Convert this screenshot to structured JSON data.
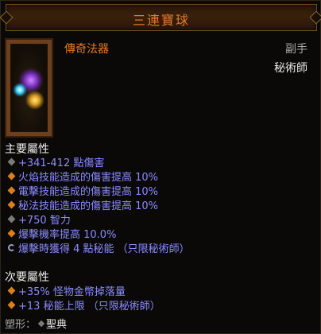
{
  "header": {
    "title": "三連寶球"
  },
  "item": {
    "type": "傳奇法器",
    "slot": "副手",
    "class_requirement": "秘術師"
  },
  "primary": {
    "title": "主要屬性",
    "stats": [
      {
        "text": "+341-412 點傷害",
        "bullet": "grey"
      },
      {
        "text": "火焰技能造成的傷害提高 10%",
        "bullet": "orange"
      },
      {
        "text": "電擊技能造成的傷害提高 10%",
        "bullet": "orange"
      },
      {
        "text": "秘法技能造成的傷害提高 10%",
        "bullet": "orange"
      },
      {
        "text": "+750 智力",
        "bullet": "grey"
      },
      {
        "text": "爆擊機率提高 10.0%",
        "bullet": "orange"
      },
      {
        "text": "爆擊時獲得 4 點秘能 （只限秘術師）",
        "bullet": "swirl"
      }
    ]
  },
  "secondary": {
    "title": "次要屬性",
    "stats": [
      {
        "text": "+35% 怪物金幣掉落量",
        "bullet": "orange"
      },
      {
        "text": "+13 秘能上限 （只限秘術師）",
        "bullet": "orange"
      }
    ]
  },
  "transmog": {
    "label": "塑形：",
    "value": "聖典"
  },
  "icon": {
    "name": "source-orb-icon"
  },
  "colors": {
    "title": "#e07a2a",
    "magic_stat": "#8b8bff",
    "orange_bullet": "#d9801c",
    "grey_bullet": "#7a7a7a"
  }
}
